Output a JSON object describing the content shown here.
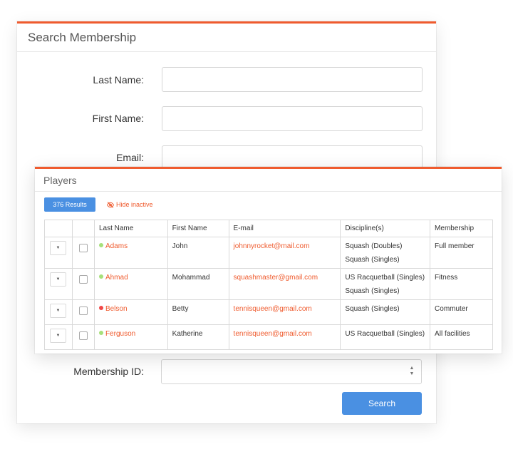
{
  "search_form": {
    "title": "Search Membership",
    "fields": {
      "last_name": {
        "label": "Last Name:",
        "value": ""
      },
      "first_name": {
        "label": "First Name:",
        "value": ""
      },
      "email": {
        "label": "Email:",
        "value": ""
      },
      "membership_id": {
        "label": "Membership ID:",
        "value": ""
      }
    },
    "search_button": "Search"
  },
  "players": {
    "title": "Players",
    "results_count": "376 Results",
    "hide_inactive": "Hide inactive",
    "columns": [
      "Last Name",
      "First Name",
      "E-mail",
      "Discipline(s)",
      "Membership"
    ],
    "rows": [
      {
        "status_color": "#a6e07a",
        "last_name": "Adams",
        "first_name": "John",
        "email": "johnnyrocket@mail.com",
        "disciplines": [
          "Squash (Doubles)",
          "Squash (Singles)"
        ],
        "membership": "Full member"
      },
      {
        "status_color": "#a6e07a",
        "last_name": "Ahmad",
        "first_name": "Mohammad",
        "email": "squashmaster@gmail.com",
        "disciplines": [
          "US Racquetball (Singles)",
          "Squash (Singles)"
        ],
        "membership": "Fitness"
      },
      {
        "status_color": "#f04848",
        "last_name": "Belson",
        "first_name": "Betty",
        "email": "tennisqueen@gmail.com",
        "disciplines": [
          "Squash (Singles)"
        ],
        "membership": "Commuter"
      },
      {
        "status_color": "#a6e07a",
        "last_name": "Ferguson",
        "first_name": "Katherine",
        "email": "tennisqueen@gmail.com",
        "disciplines": [
          "US Racquetball (Singles)"
        ],
        "membership": "All facilities"
      }
    ]
  },
  "colors": {
    "accent": "#ef5b2e",
    "primary_button": "#4a90e2",
    "active_status": "#a6e07a",
    "inactive_status": "#f04848"
  },
  "icons": {
    "hide_inactive": "eye-slash-icon",
    "row_menu": "caret-down-icon",
    "select": "sort-arrows-icon"
  }
}
